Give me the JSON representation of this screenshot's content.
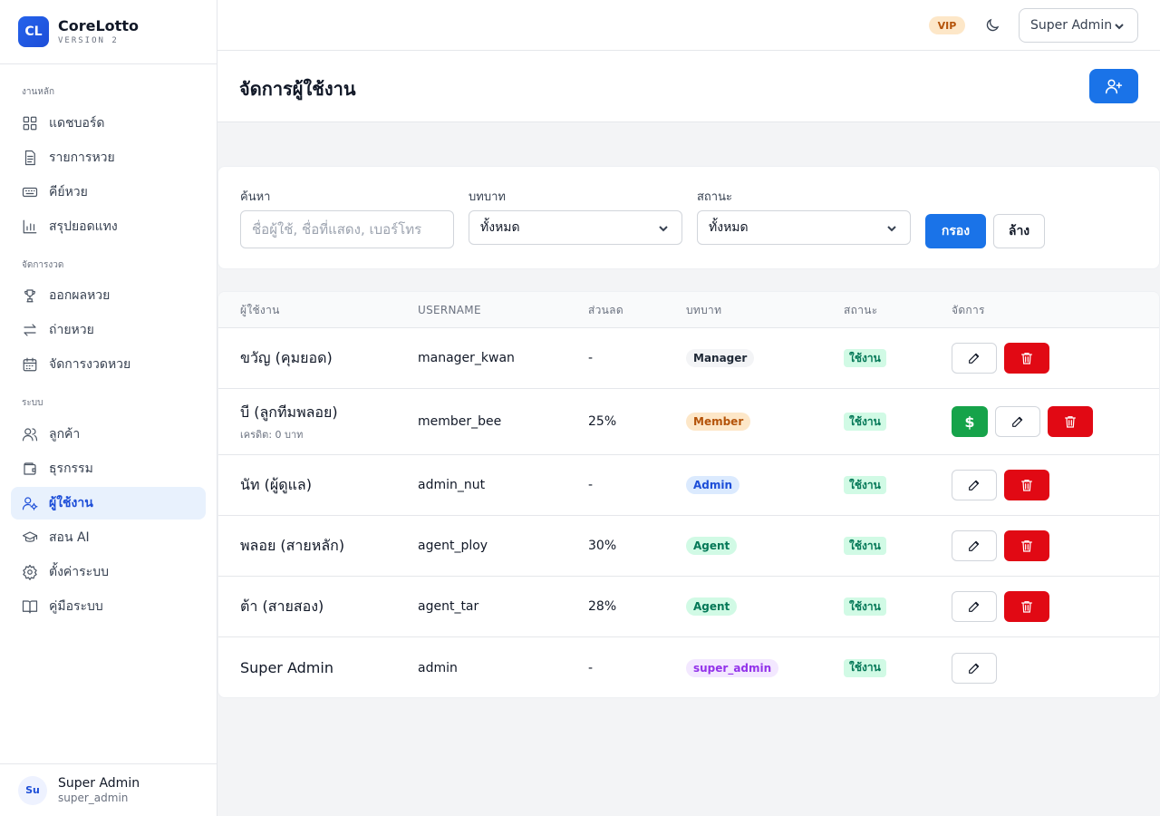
{
  "brand": {
    "logo": "CL",
    "name": "CoreLotto",
    "version": "VERSION 2"
  },
  "sidebar": {
    "sections": [
      {
        "title": "งานหลัก",
        "items": [
          {
            "label": "แดชบอร์ด",
            "icon": "dashboard-icon"
          },
          {
            "label": "รายการหวย",
            "icon": "document-icon"
          },
          {
            "label": "คีย์หวย",
            "icon": "keyboard-icon"
          },
          {
            "label": "สรุปยอดแทง",
            "icon": "bar-chart-icon"
          }
        ]
      },
      {
        "title": "จัดการงวด",
        "items": [
          {
            "label": "ออกผลหวย",
            "icon": "trophy-icon"
          },
          {
            "label": "ถ่ายหวย",
            "icon": "transfer-icon"
          },
          {
            "label": "จัดการงวดหวย",
            "icon": "calendar-icon"
          }
        ]
      },
      {
        "title": "ระบบ",
        "items": [
          {
            "label": "ลูกค้า",
            "icon": "customers-icon"
          },
          {
            "label": "ธุรกรรม",
            "icon": "wallet-icon"
          },
          {
            "label": "ผู้ใช้งาน",
            "icon": "user-settings-icon",
            "active": true
          },
          {
            "label": "สอน AI",
            "icon": "graduation-cap-icon"
          },
          {
            "label": "ตั้งค่าระบบ",
            "icon": "gear-icon"
          },
          {
            "label": "คู่มือระบบ",
            "icon": "book-icon"
          }
        ]
      }
    ],
    "footer": {
      "avatar": "Su",
      "name": "Super Admin",
      "role": "super_admin"
    }
  },
  "topbar": {
    "vip": "VIP",
    "user_menu": "Super Admin"
  },
  "page": {
    "title": "จัดการผู้ใช้งาน"
  },
  "filters": {
    "search_label": "ค้นหา",
    "search_placeholder": "ชื่อผู้ใช้, ชื่อที่แสดง, เบอร์โทร",
    "role_label": "บทบาท",
    "role_value": "ทั้งหมด",
    "status_label": "สถานะ",
    "status_value": "ทั้งหมด",
    "filter_button": "กรอง",
    "clear_button": "ล้าง"
  },
  "table": {
    "headers": {
      "user": "ผู้ใช้งาน",
      "username": "USERNAME",
      "discount": "ส่วนลด",
      "role": "บทบาท",
      "status": "สถานะ",
      "actions": "จัดการ"
    },
    "rows": [
      {
        "name": "ขวัญ (คุมยอด)",
        "credit": "",
        "username": "manager_kwan",
        "discount": "-",
        "role": "Manager",
        "role_style": "manager",
        "status": "ใช้งาน",
        "credit_button": false,
        "delete_button": true
      },
      {
        "name": "บี (ลูกทีมพลอย)",
        "credit": "เครดิต: 0 บาท",
        "username": "member_bee",
        "discount": "25%",
        "role": "Member",
        "role_style": "member",
        "status": "ใช้งาน",
        "credit_button": true,
        "delete_button": true
      },
      {
        "name": "นัท (ผู้ดูแล)",
        "credit": "",
        "username": "admin_nut",
        "discount": "-",
        "role": "Admin",
        "role_style": "admin",
        "status": "ใช้งาน",
        "credit_button": false,
        "delete_button": true
      },
      {
        "name": "พลอย (สายหลัก)",
        "credit": "",
        "username": "agent_ploy",
        "discount": "30%",
        "role": "Agent",
        "role_style": "agent",
        "status": "ใช้งาน",
        "credit_button": false,
        "delete_button": true
      },
      {
        "name": "ต้า (สายสอง)",
        "credit": "",
        "username": "agent_tar",
        "discount": "28%",
        "role": "Agent",
        "role_style": "agent",
        "status": "ใช้งาน",
        "credit_button": false,
        "delete_button": true
      },
      {
        "name": "Super Admin",
        "credit": "",
        "username": "admin",
        "discount": "-",
        "role": "super_admin",
        "role_style": "super",
        "status": "ใช้งาน",
        "credit_button": false,
        "delete_button": false
      }
    ],
    "credit_symbol": "$"
  }
}
